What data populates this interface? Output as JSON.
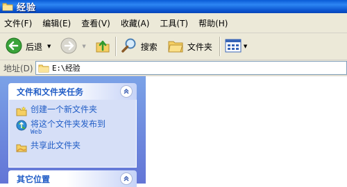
{
  "window": {
    "title": "经验"
  },
  "menu": [
    {
      "label": "文件(F)"
    },
    {
      "label": "编辑(E)"
    },
    {
      "label": "查看(V)"
    },
    {
      "label": "收藏(A)"
    },
    {
      "label": "工具(T)"
    },
    {
      "label": "帮助(H)"
    }
  ],
  "toolbar": {
    "back_label": "后退",
    "search_label": "搜索",
    "folders_label": "文件夹"
  },
  "address": {
    "label": "地址(D)",
    "value": "E:\\经验"
  },
  "tasks_panel": {
    "title": "文件和文件夹任务",
    "items": [
      {
        "label": "创建一个新文件夹",
        "icon": "new-folder-icon"
      },
      {
        "label": "将这个文件夹发布到",
        "label_line2": "Web",
        "icon": "publish-web-icon"
      },
      {
        "label": "共享此文件夹",
        "icon": "share-folder-icon"
      }
    ]
  },
  "places_panel": {
    "title": "其它位置"
  },
  "colors": {
    "titlebar": "#0a5bd6",
    "menubar": "#ece9d8",
    "taskpane": "#6375d6",
    "panel_body": "#d6dff7",
    "link": "#215dc6"
  }
}
